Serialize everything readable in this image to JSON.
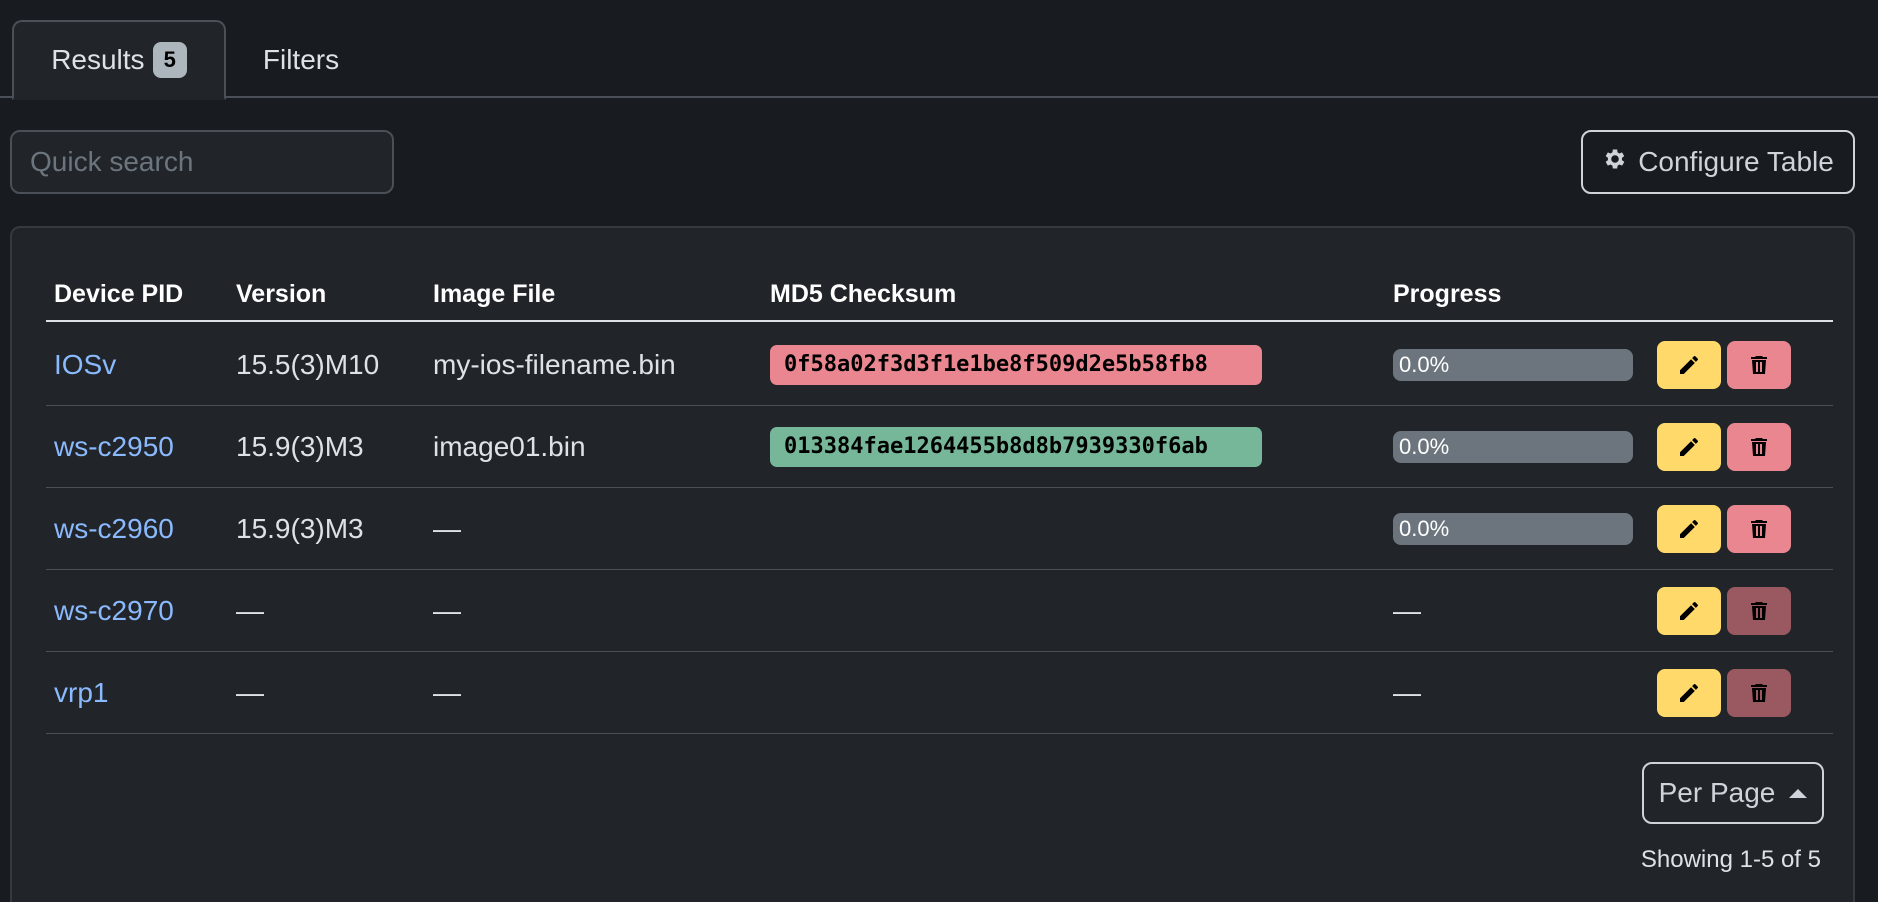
{
  "tabs": {
    "results_label": "Results",
    "results_count": "5",
    "filters_label": "Filters"
  },
  "search": {
    "placeholder": "Quick search"
  },
  "toolbar": {
    "configure_label": "Configure Table"
  },
  "table": {
    "headers": [
      "Device PID",
      "Version",
      "Image File",
      "MD5 Checksum",
      "Progress"
    ],
    "rows": [
      {
        "pid": "IOSv",
        "version": "15.5(3)M10",
        "image": "my-ios-filename.bin",
        "md5": "0f58a02f3d3f1e1be8f509d2e5b58fb8",
        "md5_status": "mismatch",
        "progress": "0.0%",
        "progress_value": 0,
        "delete_enabled": true
      },
      {
        "pid": "ws-c2950",
        "version": "15.9(3)M3",
        "image": "image01.bin",
        "md5": "013384fae1264455b8d8b7939330f6ab",
        "md5_status": "match",
        "progress": "0.0%",
        "progress_value": 0,
        "delete_enabled": true
      },
      {
        "pid": "ws-c2960",
        "version": "15.9(3)M3",
        "image": "—",
        "md5": "",
        "md5_status": "",
        "progress": "0.0%",
        "progress_value": 0,
        "delete_enabled": true
      },
      {
        "pid": "ws-c2970",
        "version": "—",
        "image": "—",
        "md5": "",
        "md5_status": "",
        "progress": "—",
        "progress_value": null,
        "delete_enabled": false
      },
      {
        "pid": "vrp1",
        "version": "—",
        "image": "—",
        "md5": "",
        "md5_status": "",
        "progress": "—",
        "progress_value": null,
        "delete_enabled": false
      }
    ]
  },
  "pagination": {
    "per_page_label": "Per Page",
    "showing": "Showing 1-5 of 5"
  },
  "colors": {
    "md5_mismatch": "#ea868f",
    "md5_match": "#75b798",
    "edit": "#ffda6a",
    "delete": "#ea868f",
    "delete_disabled": "#9a5960",
    "link": "#8bb9fe"
  },
  "icons": {
    "configure": "gear-icon",
    "edit": "pencil-icon",
    "delete": "trash-icon",
    "per_page": "caret-up-icon"
  }
}
